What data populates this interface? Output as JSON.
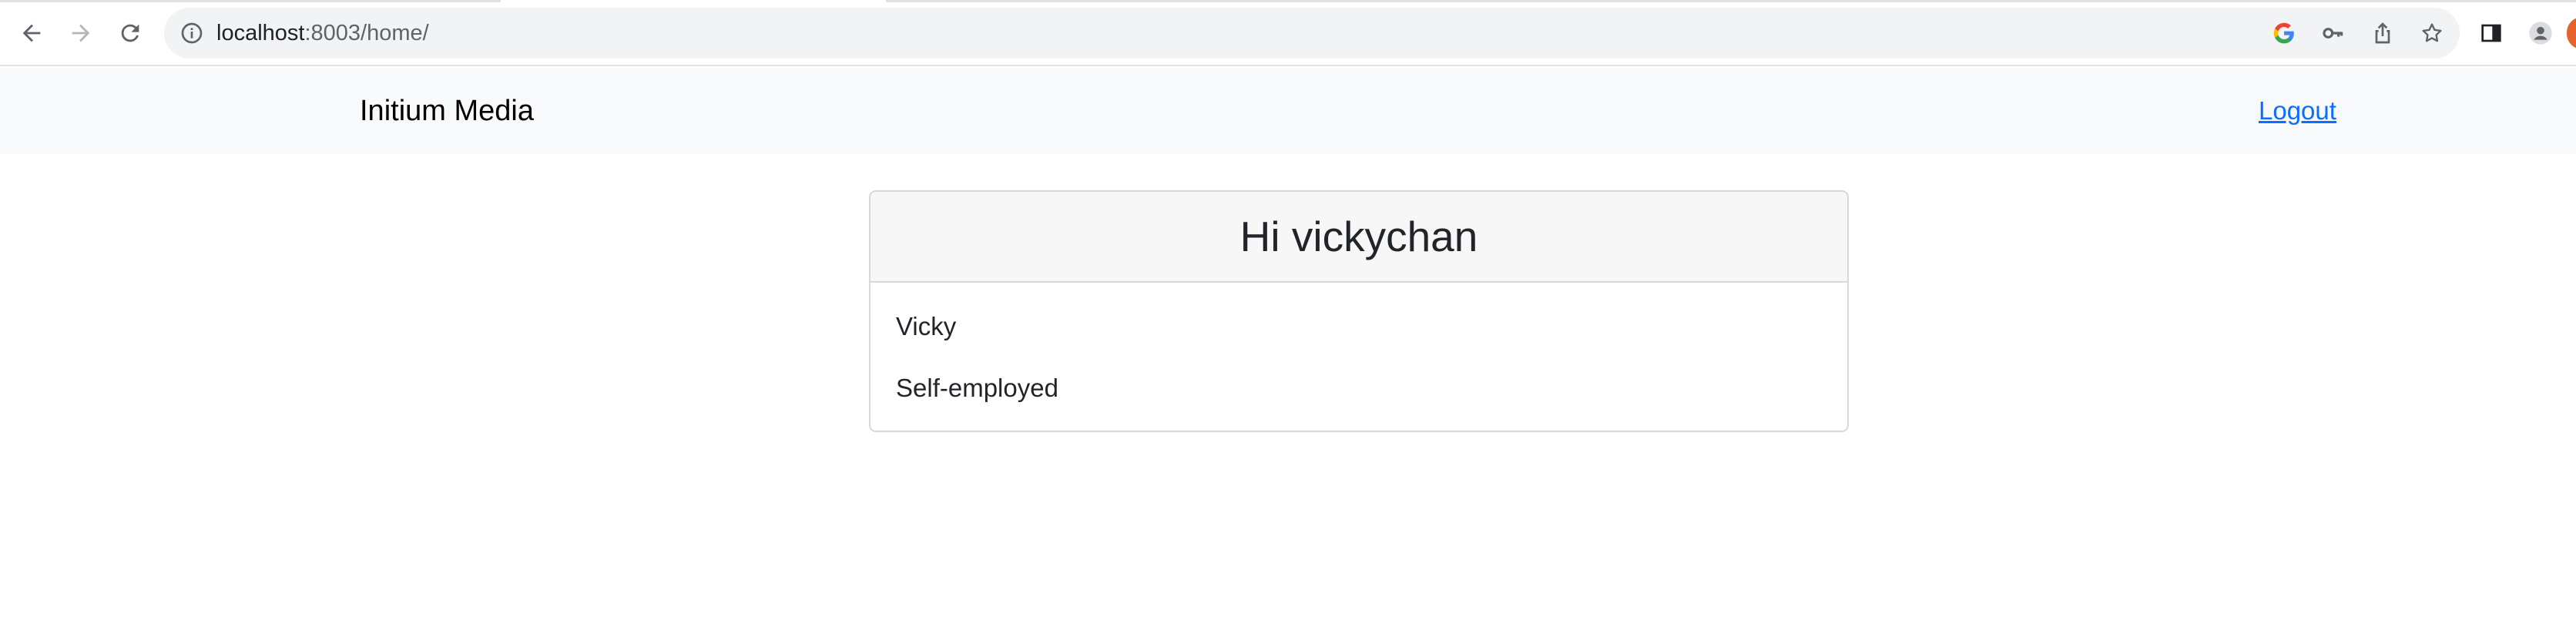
{
  "browser": {
    "url_host": "localhost",
    "url_path": ":8003/home/",
    "icons": {
      "back": "arrow-left-icon",
      "forward": "arrow-right-icon",
      "reload": "reload-icon",
      "site_info": "info-circle-icon",
      "google": "google-g-icon",
      "passwords": "key-icon",
      "share": "share-icon",
      "bookmark": "star-icon",
      "side_panel": "side-panel-icon",
      "profile": "avatar-icon"
    },
    "colors": {
      "chrome_bg": "#ffffff",
      "omnibox_bg": "#f1f3f4"
    }
  },
  "navbar": {
    "brand": "Initium Media",
    "logout_label": "Logout",
    "colors": {
      "bg": "#f8f9fa",
      "link": "#0d6efd"
    }
  },
  "card": {
    "title": "Hi vickychan",
    "lines": [
      "Vicky",
      "Self-employed"
    ]
  }
}
